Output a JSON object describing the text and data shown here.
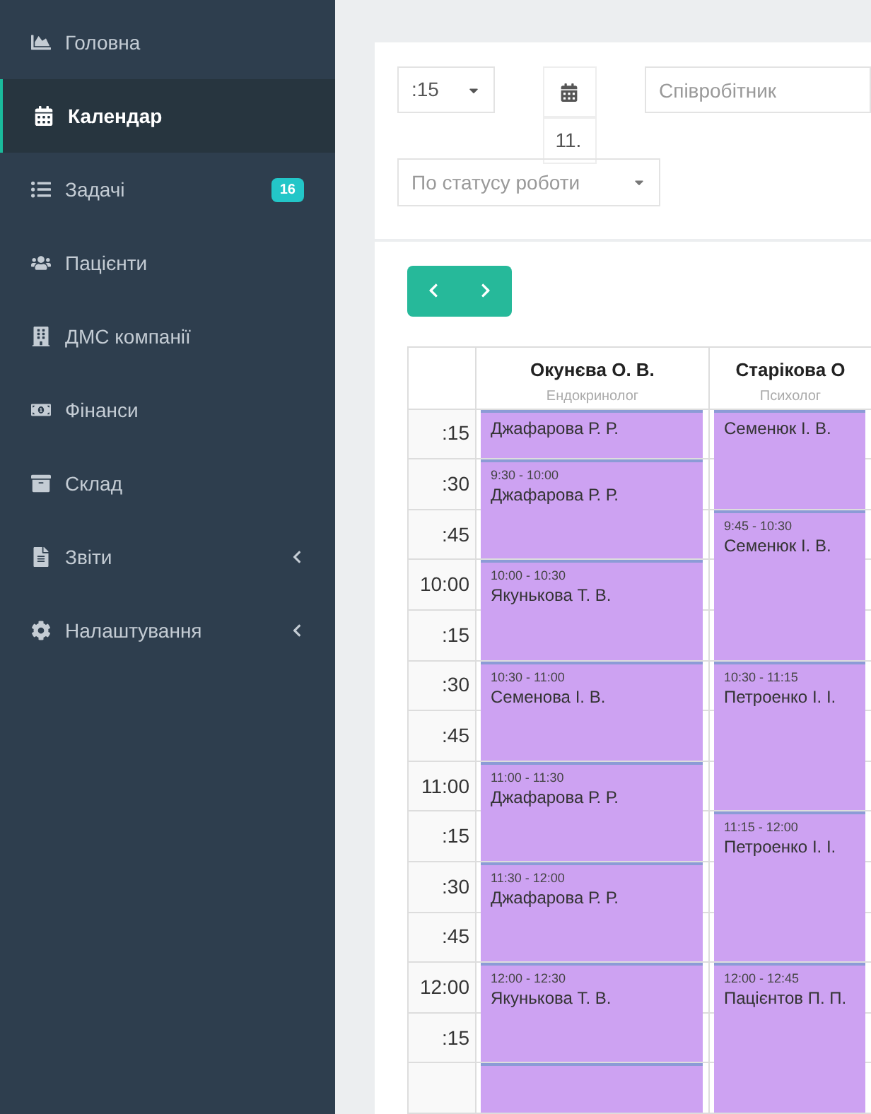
{
  "sidebar": {
    "items": [
      {
        "label": "Головна",
        "selected": false
      },
      {
        "label": "Календар",
        "selected": true
      },
      {
        "label": "Задачі",
        "selected": false,
        "badge": "16"
      },
      {
        "label": "Пацієнти",
        "selected": false
      },
      {
        "label": "ДМС компанії",
        "selected": false
      },
      {
        "label": "Фінанси",
        "selected": false
      },
      {
        "label": "Склад",
        "selected": false
      },
      {
        "label": "Звіти",
        "selected": false,
        "expandable": true
      },
      {
        "label": "Налаштування",
        "selected": false,
        "expandable": true
      }
    ]
  },
  "filters": {
    "interval": {
      "value": ":15"
    },
    "date": {
      "value": "11."
    },
    "employee": {
      "placeholder": "Співробітник"
    },
    "status": {
      "placeholder": "По статусу роботи"
    }
  },
  "calendar": {
    "slots": [
      ":15",
      ":30",
      ":45",
      "10:00",
      ":15",
      ":30",
      ":45",
      "11:00",
      ":15",
      ":30",
      ":45",
      "12:00",
      ":15"
    ],
    "columns": [
      {
        "name": "Окунєва О. В.",
        "role": "Ендокринолог",
        "events": [
          {
            "patient": "Джафарова Р. Р."
          },
          {
            "time": "9:30 - 10:00",
            "patient": "Джафарова Р. Р."
          },
          {
            "time": "10:00 - 10:30",
            "patient": "Якунькова Т. В."
          },
          {
            "time": "10:30 - 11:00",
            "patient": "Семенова І. В."
          },
          {
            "time": "11:00 - 11:30",
            "patient": "Джафарова Р. Р."
          },
          {
            "time": "11:30 - 12:00",
            "patient": "Джафарова Р. Р."
          },
          {
            "time": "12:00 - 12:30",
            "patient": "Якунькова Т. В."
          }
        ]
      },
      {
        "name": "Старікова О",
        "role": "Психолог",
        "events": [
          {
            "patient": "Семенюк І. В."
          },
          {
            "time": "9:45 - 10:30",
            "patient": "Семенюк І. В."
          },
          {
            "time": "10:30 - 11:15",
            "patient": "Петроенко І. І."
          },
          {
            "time": "11:15 - 12:00",
            "patient": "Петроенко І. І."
          },
          {
            "time": "12:00 - 12:45",
            "patient": "Пацієнтов П. П."
          }
        ]
      }
    ]
  }
}
